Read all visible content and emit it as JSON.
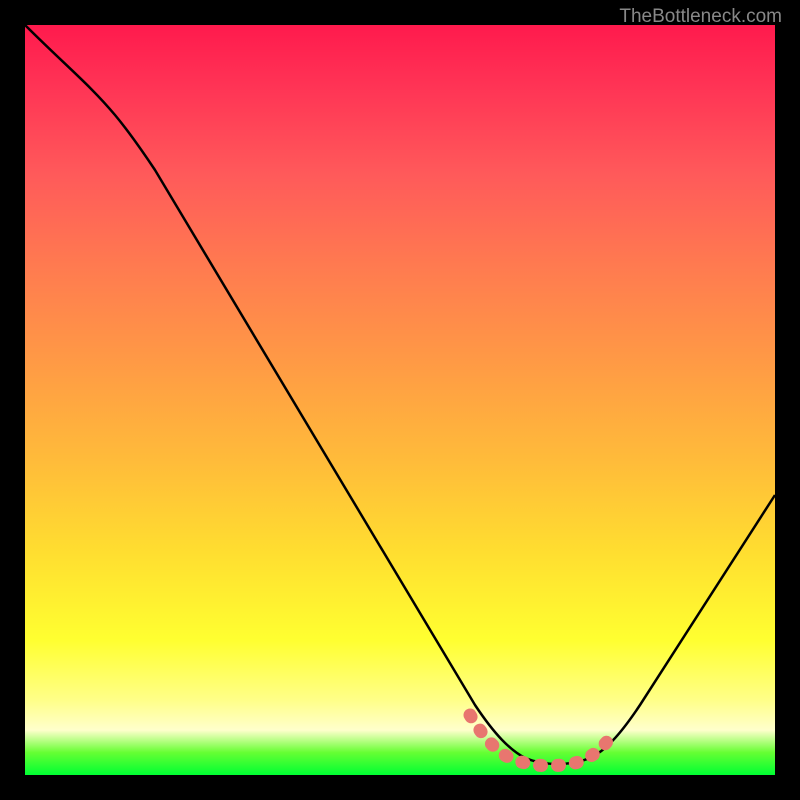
{
  "watermark": "TheBottleneck.com",
  "chart_data": {
    "type": "line",
    "title": "",
    "xlabel": "",
    "ylabel": "",
    "xlim": [
      0,
      100
    ],
    "ylim": [
      0,
      100
    ],
    "series": [
      {
        "name": "bottleneck-curve",
        "x": [
          0,
          5,
          10,
          15,
          20,
          25,
          30,
          35,
          40,
          45,
          50,
          55,
          60,
          62,
          65,
          68,
          70,
          73,
          76,
          80,
          85,
          90,
          95,
          100
        ],
        "values": [
          100,
          96,
          91,
          85,
          78,
          70,
          62,
          54,
          46,
          38,
          30,
          22,
          14,
          9,
          5,
          2,
          1,
          1,
          1,
          2,
          6,
          12,
          20,
          30
        ]
      },
      {
        "name": "optimal-zone-marker",
        "x": [
          60,
          78
        ],
        "values": [
          2,
          2
        ]
      }
    ],
    "gradient_colors": {
      "top": "#ff1a4d",
      "upper_mid": "#ff9a45",
      "mid": "#ffdd30",
      "lower_mid": "#ffff88",
      "bottom": "#00ff33"
    },
    "marker_color": "#e8766f"
  }
}
